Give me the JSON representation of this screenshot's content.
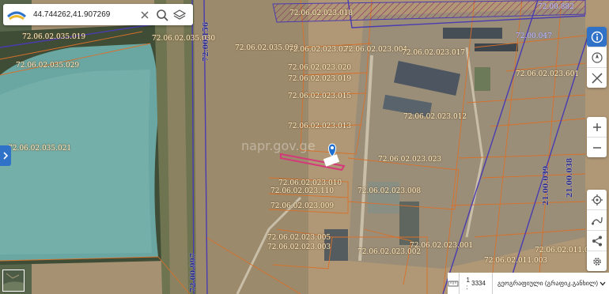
{
  "search": {
    "value": "44.744262,41.907269"
  },
  "icons": {
    "logo": "napr-logo-icon",
    "clear": "close-icon",
    "search": "search-icon",
    "layers": "layers-icon",
    "info": "info-icon",
    "compass": "compass-icon",
    "measure": "ruler-pencil-icon",
    "zoom_in": "plus-icon",
    "zoom_out": "minus-icon",
    "locate": "crosshair-icon",
    "route": "route-icon",
    "share": "share-icon",
    "settings": "gear-icon",
    "panel_toggle": "chevron-right-icon",
    "scale_ruler": "ruler-icon",
    "dropdown": "chevron-down-icon",
    "marker": "location-pin-icon"
  },
  "colors": {
    "accent": "#2f72c8",
    "parcel_boundary": "#d9702a",
    "zone_line": "#4a3bb0",
    "selected_parcel": "#d43a7a",
    "marker": "#1f6fd1"
  },
  "map": {
    "parcel_labels": [
      "72.06.02.035.019",
      "72.06.02.035.029",
      "72.06.02.035.030",
      "72.06.02.035.020",
      "72.06.02.035.021",
      "72.06.02.023.018",
      "72.06.02.023.021",
      "72.06.02.023.004",
      "72.06.02.023.017",
      "72.06.02.023.020",
      "72.06.02.023.019",
      "72.06.02.023.015",
      "72.06.02.023.013",
      "72.06.02.023.012",
      "72.06.02.023.023",
      "72.06.02.023.010",
      "72.06.02.023.110",
      "72.06.02.023.009",
      "72.06.02.023.008",
      "72.06.02.023.005",
      "72.06.02.023.003",
      "72.06.02.023.002",
      "72.06.02.023.001",
      "72.06.02.023.601",
      "72.06.02.011.003",
      "72.06.02.011.009",
      "72.00.047",
      "72.00.882",
      "72.00.156",
      "72.00.997",
      "21.00.038",
      "21.00.039"
    ]
  },
  "bottom_bar": {
    "scale_prefix": "1 :",
    "scale_value": "3334",
    "basemap_label": "გეოგრაფიული (გრაფიკ.განხილ)"
  }
}
